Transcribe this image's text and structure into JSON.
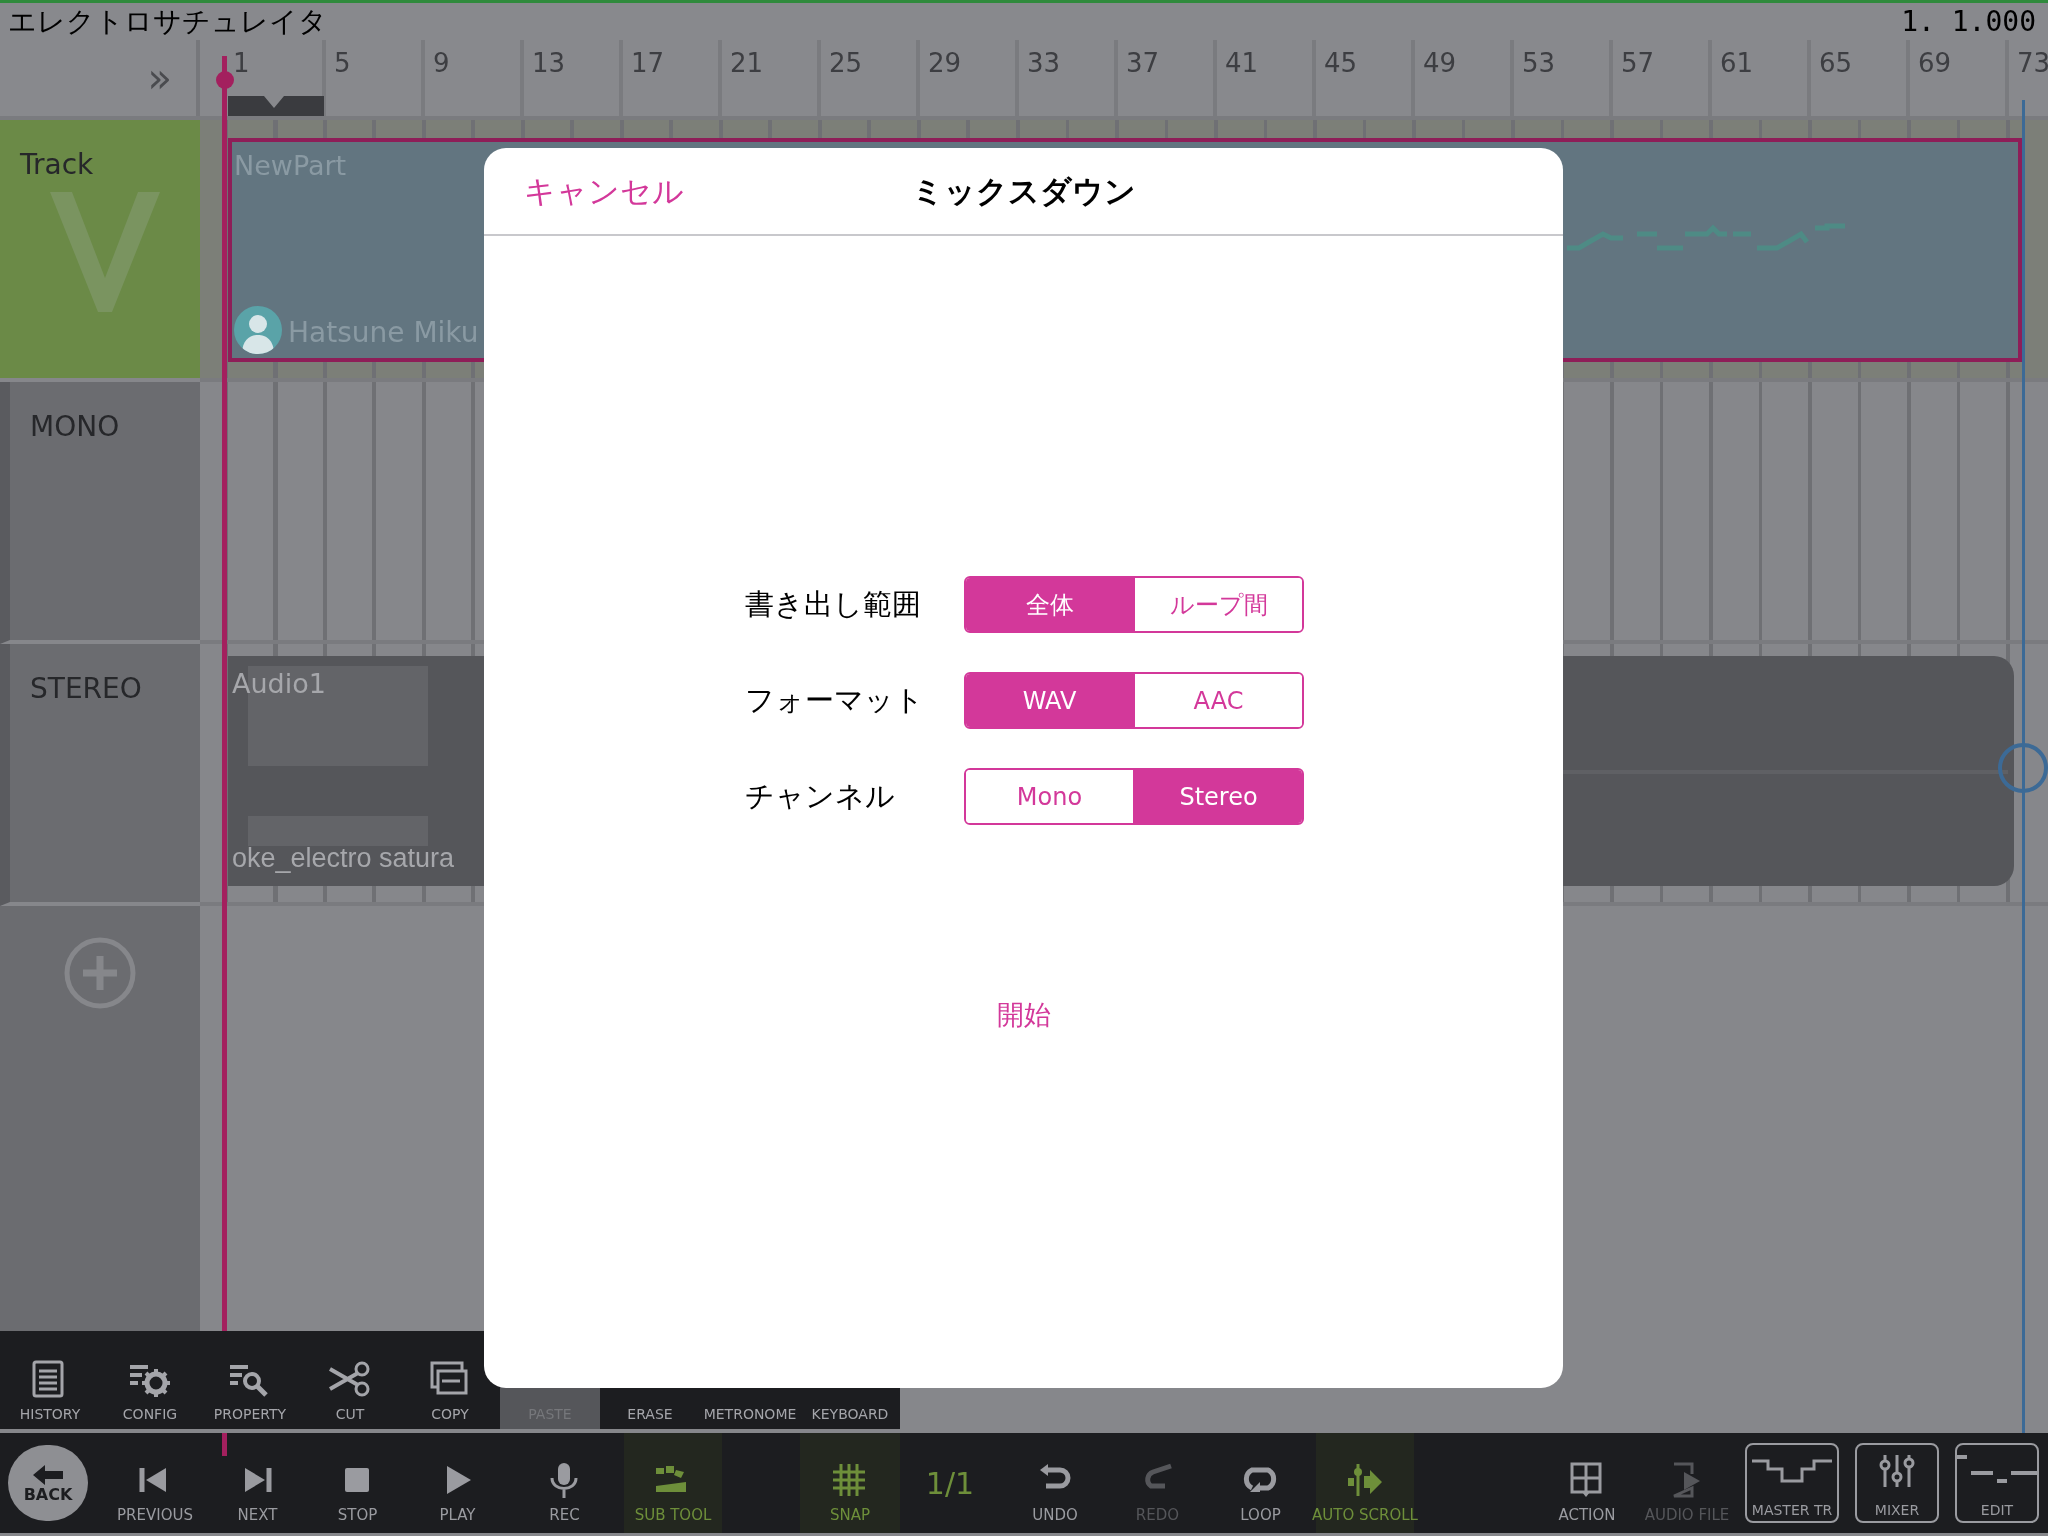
{
  "app_title": "エレクトロサチュレイタ",
  "position": "1. 1.000",
  "ruler": {
    "expand": "»",
    "marks": [
      "1",
      "5",
      "9",
      "13",
      "17",
      "21",
      "25",
      "29",
      "33",
      "37",
      "41",
      "45",
      "49",
      "53",
      "57",
      "61",
      "65",
      "69",
      "73"
    ]
  },
  "tracks": [
    {
      "name": "Track",
      "selected": true,
      "kind": "vocal",
      "part": {
        "title": "NewPart",
        "singer": "Hatsune Miku"
      }
    },
    {
      "name": "MONO",
      "selected": false,
      "kind": "mono"
    },
    {
      "name": "STEREO",
      "selected": false,
      "kind": "audio",
      "part": {
        "title": "Audio1",
        "file": "oke_electro satura"
      }
    }
  ],
  "dialog": {
    "cancel": "キャンセル",
    "title": "ミックスダウン",
    "options": [
      {
        "label": "書き出し範囲",
        "choices": [
          {
            "label": "全体",
            "selected": true
          },
          {
            "label": "ループ間",
            "selected": false
          }
        ]
      },
      {
        "label": "フォーマット",
        "choices": [
          {
            "label": "WAV",
            "selected": true
          },
          {
            "label": "AAC",
            "selected": false
          }
        ]
      },
      {
        "label": "チャンネル",
        "choices": [
          {
            "label": "Mono",
            "selected": false
          },
          {
            "label": "Stereo",
            "selected": true
          }
        ]
      }
    ],
    "start": "開始"
  },
  "sub_toolbar": [
    {
      "label": "HISTORY",
      "disabled": false,
      "kind": "icon"
    },
    {
      "label": "CONFIG",
      "disabled": false,
      "kind": "icon"
    },
    {
      "label": "PROPERTY",
      "disabled": false,
      "kind": "icon"
    },
    {
      "label": "CUT",
      "disabled": false,
      "kind": "icon"
    },
    {
      "label": "COPY",
      "disabled": false,
      "kind": "icon"
    },
    {
      "label": "PASTE",
      "disabled": true,
      "kind": "covered"
    },
    {
      "label": "ERASE",
      "disabled": false,
      "kind": "covered"
    },
    {
      "label": "METRONOME",
      "disabled": false,
      "kind": "covered"
    },
    {
      "label": "KEYBOARD",
      "disabled": false,
      "kind": "covered"
    }
  ],
  "main_toolbar": [
    {
      "label": "BACK",
      "kind": "back"
    },
    {
      "label": "PREVIOUS",
      "kind": "button",
      "active": false,
      "disabled": false
    },
    {
      "label": "NEXT",
      "kind": "button",
      "active": false,
      "disabled": false
    },
    {
      "label": "STOP",
      "kind": "button",
      "active": false,
      "disabled": false
    },
    {
      "label": "PLAY",
      "kind": "button",
      "active": false,
      "disabled": false
    },
    {
      "label": "REC",
      "kind": "button",
      "active": false,
      "disabled": false
    },
    {
      "label": "SUB TOOL",
      "kind": "button",
      "active": true,
      "disabled": false
    },
    {
      "label": "SNAP",
      "kind": "button",
      "active": true,
      "disabled": false
    },
    {
      "label": "1/1",
      "kind": "text",
      "active": true,
      "disabled": false
    },
    {
      "label": "UNDO",
      "kind": "button",
      "active": false,
      "disabled": false
    },
    {
      "label": "REDO",
      "kind": "button",
      "active": false,
      "disabled": true
    },
    {
      "label": "LOOP",
      "kind": "button",
      "active": false,
      "disabled": false
    },
    {
      "label": "AUTO SCROLL",
      "kind": "button",
      "active": true,
      "disabled": false
    },
    {
      "label": "ACTION",
      "kind": "button",
      "active": false,
      "disabled": false
    },
    {
      "label": "AUDIO FILE",
      "kind": "button",
      "active": false,
      "disabled": true
    },
    {
      "label": "MASTER TR",
      "kind": "box",
      "active": false,
      "disabled": false
    },
    {
      "label": "MIXER",
      "kind": "box",
      "active": false,
      "disabled": false
    },
    {
      "label": "EDIT",
      "kind": "box",
      "active": false,
      "disabled": false
    }
  ]
}
